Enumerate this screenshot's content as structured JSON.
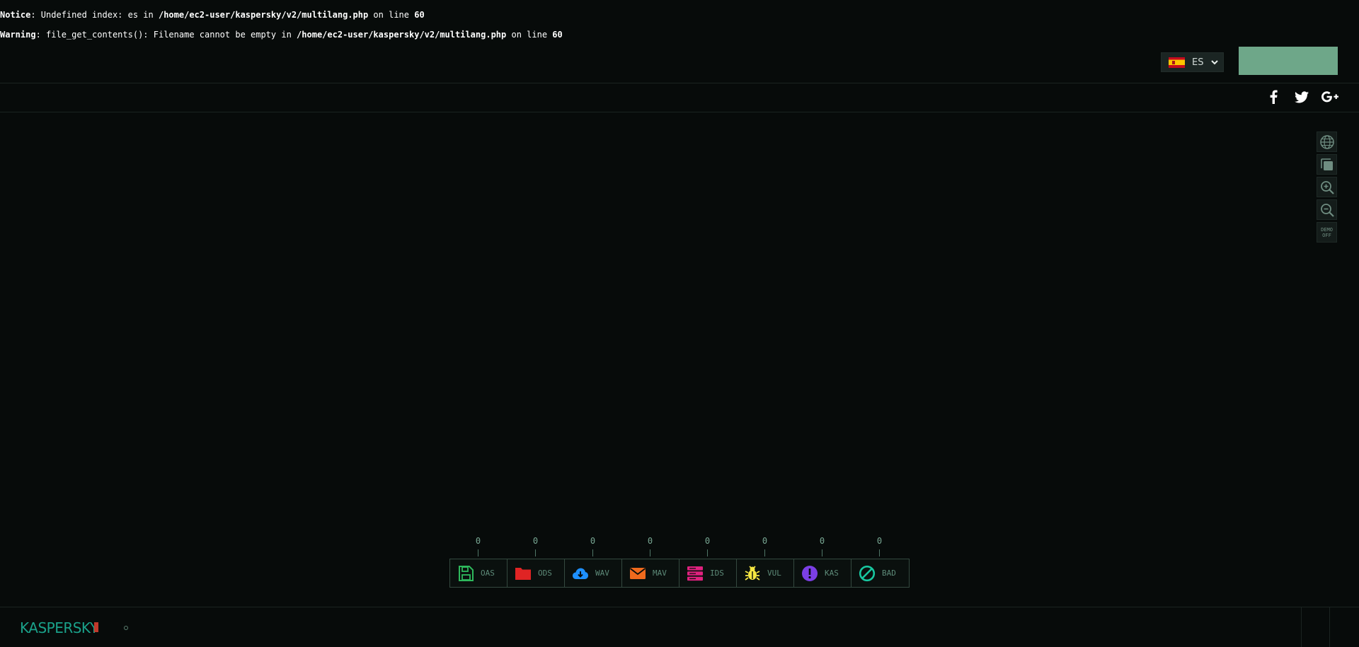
{
  "errors": {
    "notice": {
      "label": "Notice",
      "message": ": Undefined index: es in ",
      "path": "/home/ec2-user/kaspersky/v2/multilang.php",
      "line_text": " on line ",
      "line": "60"
    },
    "warning": {
      "label": "Warning",
      "message": ": file_get_contents(): Filename cannot be empty in ",
      "path": "/home/ec2-user/kaspersky/v2/multilang.php",
      "line_text": " on line ",
      "line": "60"
    }
  },
  "header": {
    "language": {
      "code": "ES",
      "flag_icon": "spain-flag-icon"
    },
    "accent_button_color": "#6ea789"
  },
  "social": [
    {
      "name": "facebook-icon"
    },
    {
      "name": "twitter-icon"
    },
    {
      "name": "google-plus-icon"
    }
  ],
  "tools": {
    "demo_line1": "DEMO",
    "demo_line2": "OFF"
  },
  "legend": [
    {
      "label": "OAS",
      "count": "0",
      "color": "#2eb85c",
      "icon": "floppy-disk-icon"
    },
    {
      "label": "ODS",
      "count": "0",
      "color": "#e02424",
      "icon": "folder-icon"
    },
    {
      "label": "WAV",
      "count": "0",
      "color": "#1e90ff",
      "icon": "cloud-download-icon"
    },
    {
      "label": "MAV",
      "count": "0",
      "color": "#f06a1d",
      "icon": "envelope-icon"
    },
    {
      "label": "IDS",
      "count": "0",
      "color": "#e0217f",
      "icon": "server-icon"
    },
    {
      "label": "VUL",
      "count": "0",
      "color": "#f5e642",
      "icon": "bug-icon"
    },
    {
      "label": "KAS",
      "count": "0",
      "color": "#7b3fe4",
      "icon": "exclamation-circle-icon"
    },
    {
      "label": "BAD",
      "count": "0",
      "color": "#18c7a0",
      "icon": "ban-icon"
    }
  ],
  "footer": {
    "logo_text": "KASPERSKY",
    "logo_badge": "lab"
  }
}
